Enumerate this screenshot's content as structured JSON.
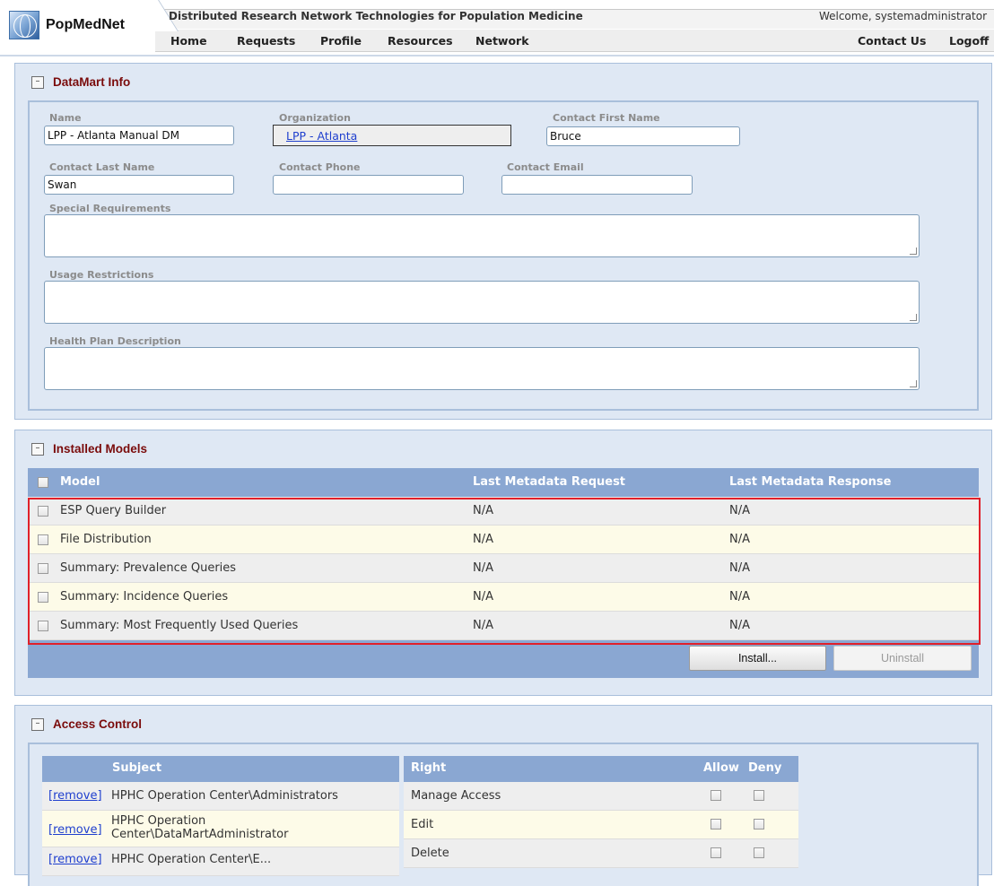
{
  "header": {
    "logo_text": "PopMedNet",
    "title": "Distributed Research Network Technologies for Population Medicine",
    "welcome": "Welcome, systemadministrator",
    "nav": [
      "Home",
      "Requests",
      "Profile",
      "Resources",
      "Network"
    ],
    "nav_right": [
      "Contact Us",
      "Logoff"
    ]
  },
  "datamart_info": {
    "title": "DataMart Info",
    "collapse_glyph": "–",
    "fields": {
      "name": {
        "label": "Name",
        "value": "LPP - Atlanta Manual DM"
      },
      "organization": {
        "label": "Organization",
        "value": "LPP - Atlanta"
      },
      "contact_first_name": {
        "label": "Contact First Name",
        "value": "Bruce"
      },
      "contact_last_name": {
        "label": "Contact Last Name",
        "value": "Swan"
      },
      "contact_phone": {
        "label": "Contact Phone",
        "value": ""
      },
      "contact_email": {
        "label": "Contact Email",
        "value": ""
      },
      "special_requirements": {
        "label": "Special Requirements",
        "value": ""
      },
      "usage_restrictions": {
        "label": "Usage Restrictions",
        "value": ""
      },
      "health_plan_description": {
        "label": "Health Plan Description",
        "value": ""
      }
    }
  },
  "installed_models": {
    "title": "Installed Models",
    "collapse_glyph": "–",
    "columns": [
      "Model",
      "Last Metadata Request",
      "Last Metadata Response"
    ],
    "rows": [
      {
        "model": "ESP Query Builder",
        "request": "N/A",
        "response": "N/A"
      },
      {
        "model": "File Distribution",
        "request": "N/A",
        "response": "N/A"
      },
      {
        "model": "Summary: Prevalence Queries",
        "request": "N/A",
        "response": "N/A"
      },
      {
        "model": "Summary: Incidence Queries",
        "request": "N/A",
        "response": "N/A"
      },
      {
        "model": "Summary: Most Frequently Used Queries",
        "request": "N/A",
        "response": "N/A"
      }
    ],
    "install_label": "Install...",
    "uninstall_label": "Uninstall"
  },
  "access_control": {
    "title": "Access Control",
    "collapse_glyph": "–",
    "subject_header": "Subject",
    "right_header": "Right",
    "allow_header": "Allow",
    "deny_header": "Deny",
    "remove_label": "[remove]",
    "subjects": [
      {
        "name": "HPHC Operation Center\\Administrators"
      },
      {
        "name": "HPHC Operation Center\\DataMartAdministrator"
      },
      {
        "name": "HPHC Operation Center\\E..."
      }
    ],
    "rights": [
      "Manage Access",
      "Edit",
      "Delete"
    ]
  }
}
